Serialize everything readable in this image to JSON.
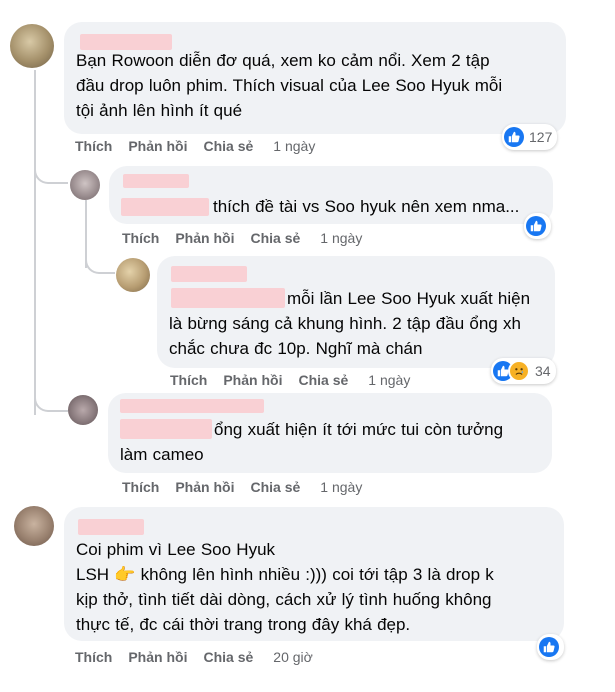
{
  "actions": {
    "like": "Thích",
    "reply": "Phản hồi",
    "share": "Chia sẻ"
  },
  "comments": [
    {
      "text": "Bạn Rowoon diễn đơ quá, xem ko cảm nổi. Xem 2 tập\nđầu drop luôn phim. Thích visual của Lee Soo Hyuk mỗi\ntội ảnh lên hình ít qué",
      "time": "1 ngày",
      "reactions": {
        "types": [
          "like"
        ],
        "count": "127"
      },
      "replies": [
        {
          "text": "thích đề tài vs Soo hyuk nên xem nma...",
          "time": "1 ngày",
          "reactions": {
            "types": [
              "like"
            ],
            "count": ""
          }
        },
        {
          "text": "mỗi lần Lee Soo Hyuk xuất hiện\nlà bừng sáng cả khung hình. 2 tập đầu ổng xh\nchắc chưa đc 10p. Nghĩ mà chán",
          "time": "1 ngày",
          "reactions": {
            "types": [
              "like",
              "sad"
            ],
            "count": "34"
          }
        },
        {
          "text": "ổng xuất hiện ít tới mức tui còn tưởng\nlàm cameo",
          "time": "1 ngày",
          "reactions": {
            "types": [],
            "count": ""
          }
        }
      ]
    },
    {
      "text": "Coi phim vì Lee Soo Hyuk\nLSH 👉 không lên hình nhiều :))) coi tới tập 3 là drop k\nkịp thở, tình tiết dài dòng, cách xử lý tình huống không\nthực tế, đc cái thời trang trong đây khá đẹp.",
      "time": "20 giờ",
      "reactions": {
        "types": [
          "like"
        ],
        "count": ""
      }
    }
  ],
  "colors": {
    "bubble": "#f0f2f5",
    "like": "#1877f2",
    "sad": "#f7b125",
    "meta": "#65676b",
    "name_redacted": "#f9d0d4"
  },
  "icons": {
    "like": "thumbs-up-icon",
    "sad": "sad-face-icon",
    "point": "backhand-index-pointing-right"
  }
}
